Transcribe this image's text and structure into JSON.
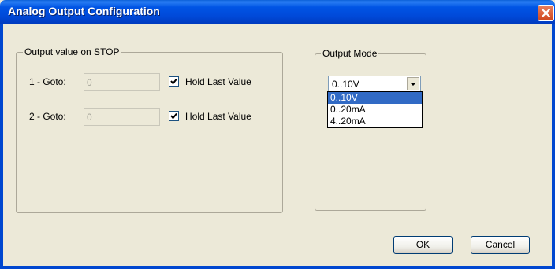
{
  "window": {
    "title": "Analog Output Configuration"
  },
  "stop_group": {
    "legend": "Output value on STOP",
    "rows": [
      {
        "label": "1 - Goto:",
        "value": "0",
        "hold_label": "Hold Last Value",
        "hold_checked": true
      },
      {
        "label": "2 - Goto:",
        "value": "0",
        "hold_label": "Hold Last Value",
        "hold_checked": true
      }
    ]
  },
  "mode_group": {
    "legend": "Output Mode",
    "selected": "0..10V",
    "options": [
      "0..10V",
      "0..20mA",
      "4..20mA"
    ]
  },
  "buttons": {
    "ok": "OK",
    "cancel": "Cancel"
  },
  "icons": {
    "close": "close-icon",
    "dropdown": "chevron-down-icon",
    "check": "check-icon"
  },
  "colors": {
    "titlebar": "#0055e5",
    "selection": "#316ac5",
    "close": "#d0451b"
  }
}
